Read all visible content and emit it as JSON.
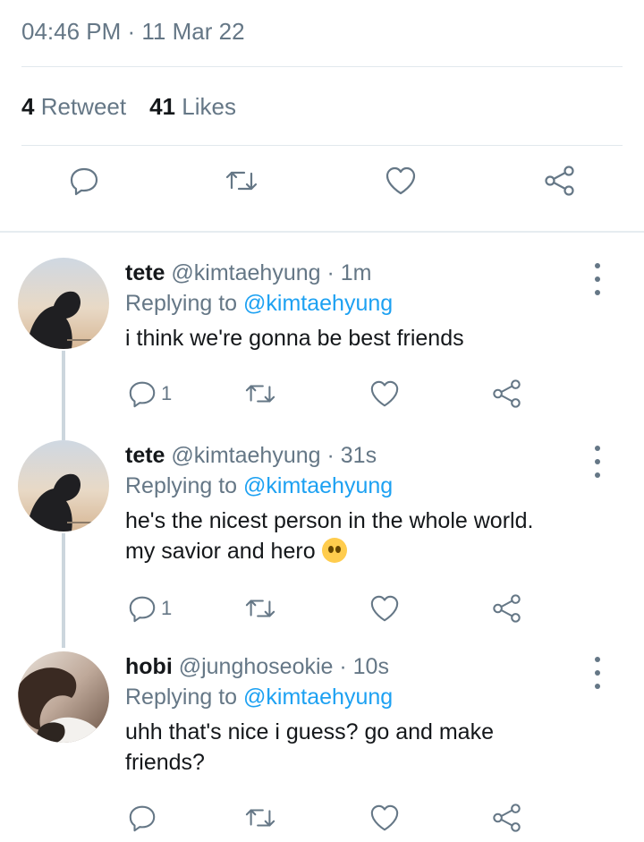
{
  "tweet": {
    "timestamp": "04:46 PM · 11 Mar 22",
    "retweet_count": "4",
    "retweet_label": "Retweet",
    "like_count": "41",
    "like_label": "Likes"
  },
  "replies": [
    {
      "name": "tete",
      "handle": "@kimtaehyung · 1m",
      "replying_prefix": "Replying to",
      "replying_to": "@kimtaehyung",
      "text": "i think we're gonna be best friends",
      "reply_count": "1"
    },
    {
      "name": "tete",
      "handle": "@kimtaehyung · 31s",
      "replying_prefix": "Replying to",
      "replying_to": "@kimtaehyung",
      "text_line1": "he's the nicest person in the whole world.",
      "text_line2": "my savior and hero",
      "emoji": "pleading-face",
      "reply_count": "1"
    },
    {
      "name": "hobi",
      "handle": "@junghoseokie · 10s",
      "replying_prefix": "Replying to",
      "replying_to": "@kimtaehyung",
      "text_line1": "uhh that's nice i guess? go and make",
      "text_line2": "friends?",
      "reply_count": ""
    }
  ],
  "icons": [
    "reply-icon",
    "retweet-icon",
    "like-icon",
    "share-icon",
    "more-icon"
  ],
  "colors": {
    "text": "#14171a",
    "muted": "#657786",
    "link": "#1da1f2",
    "divider": "#e1e8ed"
  }
}
